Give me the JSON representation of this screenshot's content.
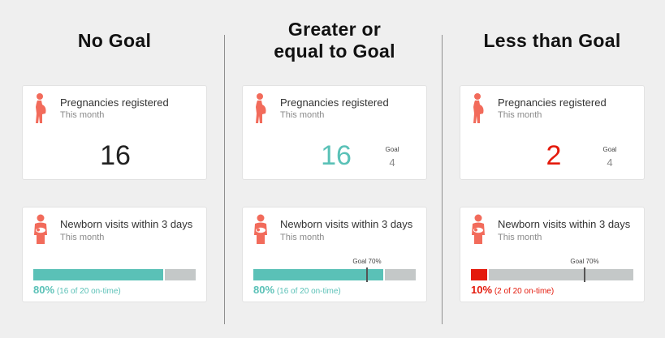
{
  "colors": {
    "teal": "#5ac1b7",
    "red": "#e41a0c",
    "track": "#c4c8c8",
    "icon": "#f26b5b"
  },
  "columns": {
    "no_goal": {
      "title": "No Goal",
      "pregnancies": {
        "title": "Pregnancies registered",
        "subtitle": "This month",
        "value": "16"
      },
      "newborn": {
        "title": "Newborn visits within 3 days",
        "subtitle": "This month",
        "percent_text": "80%",
        "detail": "(16 of 20 on-time)",
        "progress": 0.8
      }
    },
    "greater": {
      "title_line1": "Greater or",
      "title_line2": "equal to Goal",
      "pregnancies": {
        "title": "Pregnancies registered",
        "subtitle": "This month",
        "value": "16",
        "goal_label": "Goal",
        "goal_value": "4"
      },
      "newborn": {
        "title": "Newborn visits within 3 days",
        "subtitle": "This month",
        "percent_text": "80%",
        "detail": "(16 of 20 on-time)",
        "goal_marker_label": "Goal 70%",
        "progress": 0.8,
        "goal": 0.7
      }
    },
    "less": {
      "title": "Less than Goal",
      "pregnancies": {
        "title": "Pregnancies registered",
        "subtitle": "This month",
        "value": "2",
        "goal_label": "Goal",
        "goal_value": "4"
      },
      "newborn": {
        "title": "Newborn visits within 3 days",
        "subtitle": "This month",
        "percent_text": "10%",
        "detail": "(2 of 20 on-time)",
        "goal_marker_label": "Goal 70%",
        "progress": 0.1,
        "goal": 0.7
      }
    }
  }
}
